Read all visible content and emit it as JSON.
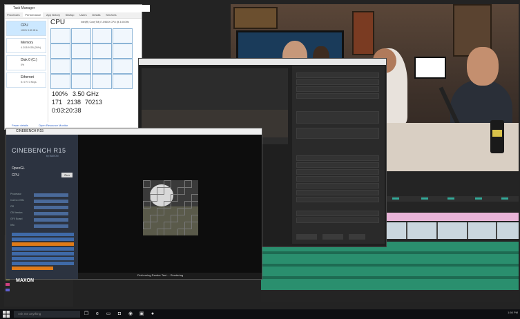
{
  "taskmgr": {
    "title": "Task Manager",
    "tabs": [
      "Processes",
      "Performance",
      "App history",
      "Startup",
      "Users",
      "Details",
      "Services"
    ],
    "side_items": [
      {
        "label": "CPU",
        "sub": "100% 3.50 GHz"
      },
      {
        "label": "Memory",
        "sub": "4.2/15.9 GB (26%)"
      },
      {
        "label": "Disk 0 (C:)",
        "sub": "0%"
      },
      {
        "label": "Ethernet",
        "sub": "S: 0 R: 0 Kbps"
      }
    ],
    "heading": "CPU",
    "cpu_model": "Intel(R) Core(TM) i7-5960X CPU @ 3.00GHz",
    "utilization": "100%",
    "speed": "3.50 GHz",
    "processes": "171",
    "threads": "2138",
    "handles": "70213",
    "uptime": "0:03:20:38",
    "fewer_details": "Fewer details",
    "open_resmon": "Open Resource Monitor"
  },
  "cinebench": {
    "window_title": "CINEBENCH R15",
    "logo": "CINEBENCH R15",
    "logo_sub": "by MAXON",
    "opengl_label": "OpenGL",
    "cpu_label": "CPU",
    "run_label": "Run",
    "info_rows": [
      "Processor",
      "Cores x GHz",
      "OS",
      "CB Version",
      "GFX Board",
      "Info"
    ],
    "maxon": "MAXON",
    "status": "Performing Render Test ... Rendering"
  },
  "taskbar": {
    "search_placeholder": "Ask me anything",
    "clock": "1:50 PM"
  },
  "colors": {
    "accent": "#e07b18",
    "rank_bar": "#3f6aa8",
    "audio_track": "#2a8f6e",
    "pink_clip": "#e8b4d8"
  }
}
